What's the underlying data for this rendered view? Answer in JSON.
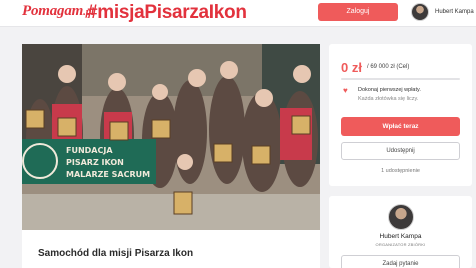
{
  "header": {
    "logo": "Pomagam",
    "logo_ext": ".pl",
    "hashtag": "#misjaPisarzaIkon",
    "login_label": "Zaloguj",
    "user_name": "Hubert Kampa"
  },
  "campaign": {
    "title": "Samochód dla misji Pisarza Ikon",
    "banner_line1": "FUNDACJA",
    "banner_line2": "PISARZ IKON",
    "banner_line3": "MALARZE SACRUM"
  },
  "sidebar": {
    "amount": "0 zł",
    "goal": "/ 69 000 zł (Cel)",
    "progress_fraction": 0,
    "pledge_text": "Dokonaj pierwszej wpłaty.",
    "pledge_sub": "Każda złotówka się liczy.",
    "donate_label": "Wpłać teraz",
    "share_label": "Udostępnij",
    "shares_text": "1 udostępnienie"
  },
  "organizer": {
    "name": "Hubert Kampa",
    "role": "ORGANIZATOR ZBIÓRKI",
    "ask_label": "Zadaj pytanie"
  },
  "colors": {
    "accent": "#ef5b5b",
    "brand": "#e2323d",
    "banner": "#1f6b56"
  }
}
